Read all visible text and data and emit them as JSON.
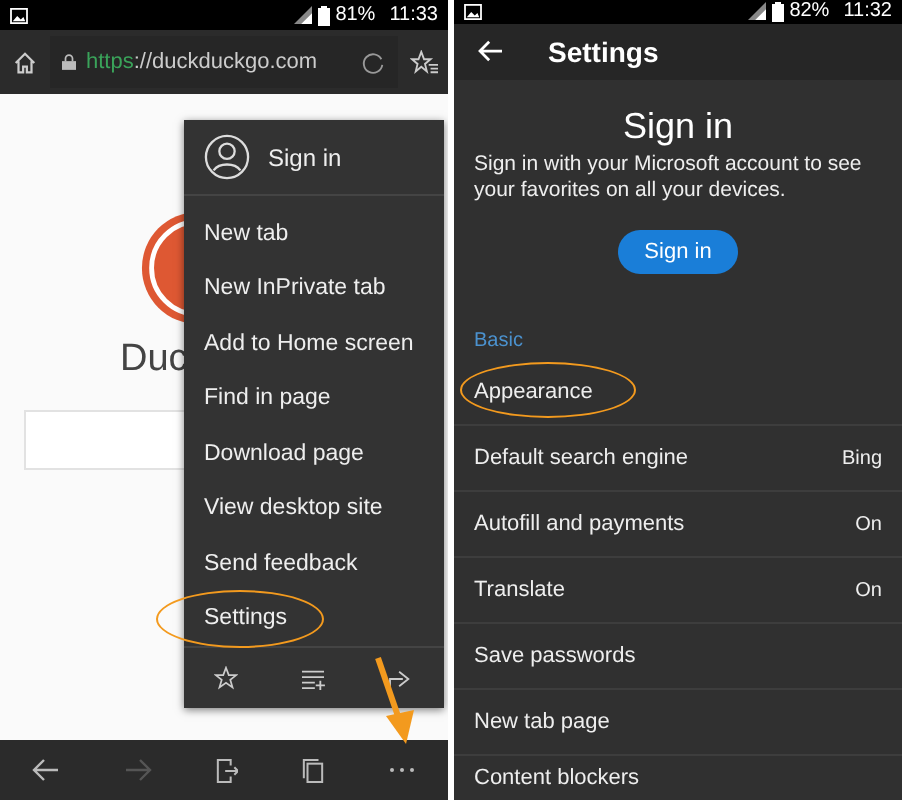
{
  "browser_screen": {
    "status_bar": {
      "battery": "81%",
      "time": "11:33"
    },
    "address_bar": {
      "scheme": "https",
      "address": "://duckduckgo.com"
    },
    "page": {
      "logo_text": "Duc"
    },
    "menu": {
      "account": "Sign in",
      "items": [
        {
          "label": "New tab",
          "circled": false
        },
        {
          "label": "New InPrivate tab",
          "circled": false
        },
        {
          "label": "Add to Home screen",
          "circled": false
        },
        {
          "label": "Find in page",
          "circled": false
        },
        {
          "label": "Download page",
          "circled": false
        },
        {
          "label": "View desktop site",
          "circled": false
        },
        {
          "label": "Send feedback",
          "circled": false
        },
        {
          "label": "Settings",
          "circled": true
        }
      ]
    },
    "bottom_bar": [
      {
        "kind": "back",
        "disabled": false
      },
      {
        "kind": "forward",
        "disabled": true
      },
      {
        "kind": "exit",
        "disabled": false
      },
      {
        "kind": "tabs",
        "disabled": false
      },
      {
        "kind": "more",
        "disabled": false
      }
    ]
  },
  "settings_screen": {
    "status_bar": {
      "battery": "82%",
      "time": "11:32"
    },
    "title": "Settings",
    "sign_in": {
      "heading": "Sign in",
      "text": "Sign in with your Microsoft account to see your favorites on all your devices.",
      "button": "Sign in"
    },
    "section": "Basic",
    "rows": [
      {
        "label": "Appearance",
        "circled": true
      },
      {
        "label": "Default search engine",
        "value": "Bing",
        "circled": false
      },
      {
        "label": "Autofill and payments",
        "value": "On",
        "circled": false
      },
      {
        "label": "Translate",
        "value": "On",
        "circled": false
      },
      {
        "label": "Save passwords",
        "circled": false
      },
      {
        "label": "New tab page",
        "circled": false
      },
      {
        "label": "Content blockers",
        "circled": false
      }
    ]
  }
}
